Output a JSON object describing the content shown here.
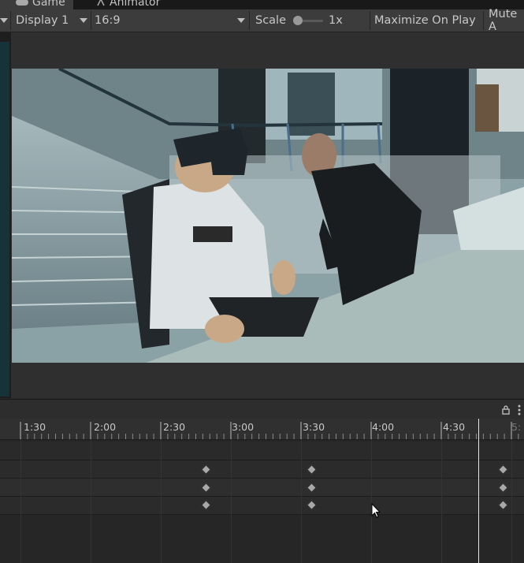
{
  "tabs": [
    {
      "label": "Game",
      "icon": "gamepad-icon"
    },
    {
      "label": "Animator",
      "icon": "animator-icon"
    }
  ],
  "toolbar": {
    "display": "Display 1",
    "aspect": "16:9",
    "scale_label": "Scale",
    "scale_value": "1x",
    "maximize": "Maximize On Play",
    "mute": "Mute A"
  },
  "timeline": {
    "ticks": [
      "1:30",
      "2:00",
      "2:30",
      "3:00",
      "3:30",
      "4:00",
      "4:30",
      "5:"
    ]
  },
  "colors": {
    "toolbar_bg": "#3c3c3c",
    "panel_bg": "#282828",
    "playhead": "#e6e6e6"
  }
}
